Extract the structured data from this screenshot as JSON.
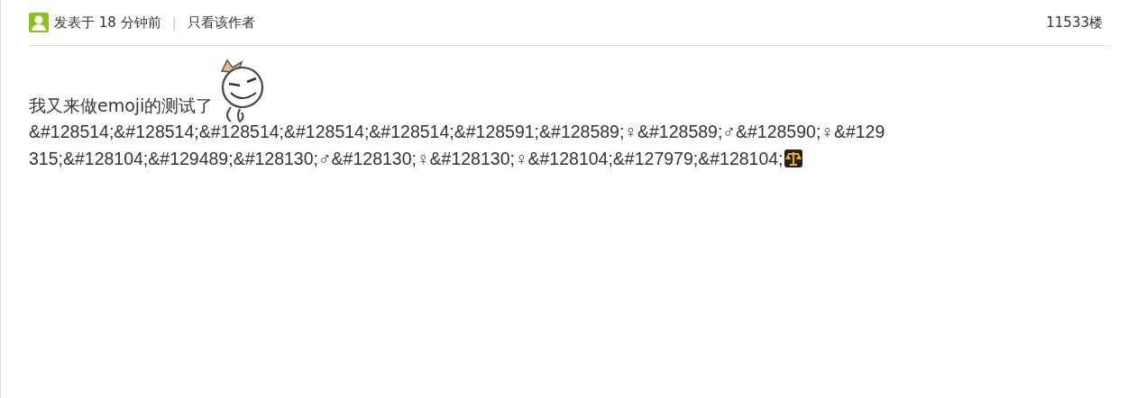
{
  "post_header": {
    "posted": "发表于 18 分钟前",
    "separator": "|",
    "author_only_link": "只看该作者",
    "floor": "11533楼"
  },
  "post_body": {
    "first_line": "我又来做emoji的测试了",
    "entity_lines": [
      "&#128514;&#128514;&#128514;&#128514;&#128514;&#128591;&#128589;♀&#128589;♂&#128590;♀&#129",
      "315;&#128104;&#129489;&#128130;♂&#128130;♀&#128130;♀&#128104;&#127979;&#128104;"
    ]
  }
}
